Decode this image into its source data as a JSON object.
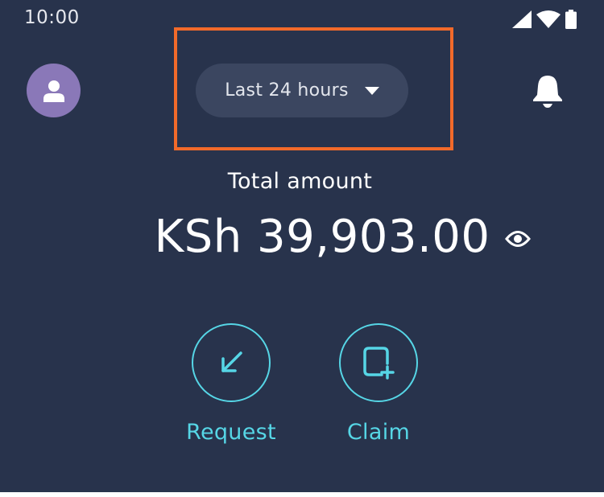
{
  "status_bar": {
    "time": "10:00",
    "icons": [
      "signal-icon",
      "wifi-icon",
      "battery-icon"
    ]
  },
  "header": {
    "avatar_icon": "person-icon",
    "time_filter": {
      "label": "Last 24 hours",
      "icon": "caret-down-icon"
    },
    "notification_icon": "bell-icon"
  },
  "balance": {
    "label": "Total amount",
    "amount": "KSh 39,903.00",
    "visibility_icon": "eye-icon"
  },
  "actions": [
    {
      "label": "Request",
      "icon": "arrow-down-left-icon"
    },
    {
      "label": "Claim",
      "icon": "claim-add-icon"
    }
  ],
  "colors": {
    "background": "#28334c",
    "accent": "#56d6e6",
    "avatar": "#8a78b8",
    "filter_pill": "#3b4660",
    "highlight": "#f26a2a"
  }
}
